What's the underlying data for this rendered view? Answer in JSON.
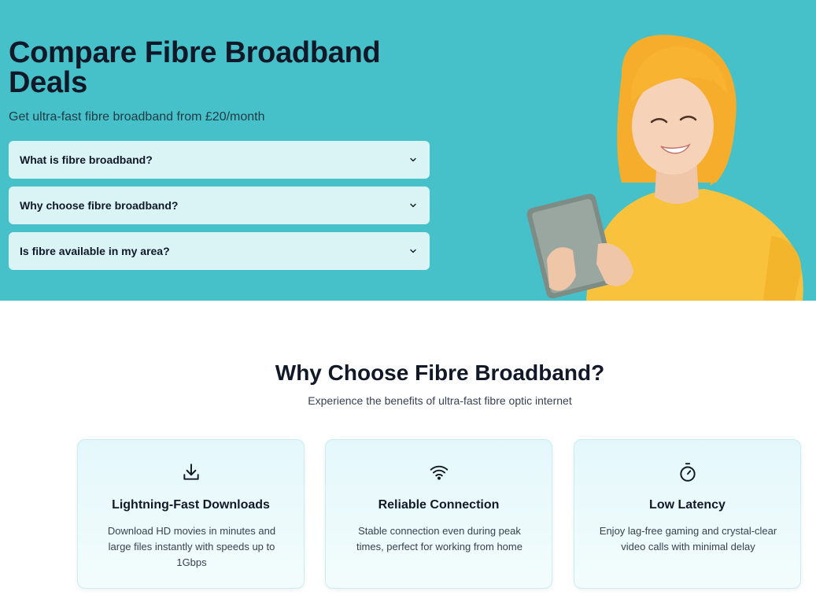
{
  "hero": {
    "title": "Compare Fibre Broadband Deals",
    "subtitle": "Get ultra-fast fibre broadband from £20/month",
    "faqs": [
      {
        "question": "What is fibre broadband?"
      },
      {
        "question": "Why choose fibre broadband?"
      },
      {
        "question": "Is fibre available in my area?"
      }
    ]
  },
  "benefits": {
    "title": "Why Choose Fibre Broadband?",
    "subtitle": "Experience the benefits of ultra-fast fibre optic internet",
    "cards": [
      {
        "icon": "download-icon",
        "title": "Lightning-Fast Downloads",
        "text": "Download HD movies in minutes and large files instantly with speeds up to 1Gbps"
      },
      {
        "icon": "wifi-icon",
        "title": "Reliable Connection",
        "text": "Stable connection even during peak times, perfect for working from home"
      },
      {
        "icon": "stopwatch-icon",
        "title": "Low Latency",
        "text": "Enjoy lag-free gaming and crystal-clear video calls with minimal delay"
      }
    ]
  },
  "colors": {
    "hero_bg": "#46c0c9",
    "faq_bg": "#daf4f6",
    "card_bg": "#e4f8fb"
  }
}
